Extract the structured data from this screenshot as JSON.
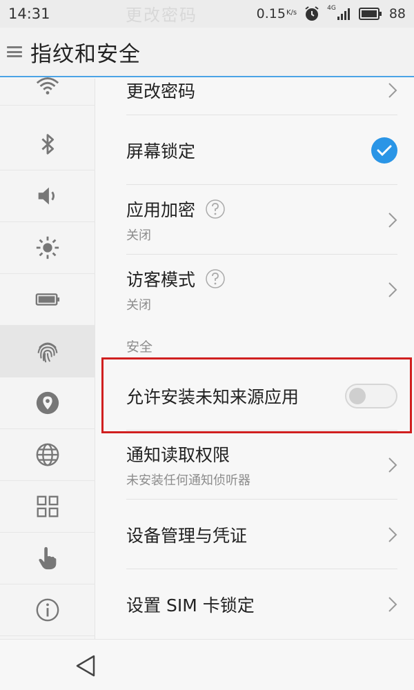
{
  "status_bar": {
    "time": "14:31",
    "speed": "0.15",
    "speed_unit": "K/s",
    "network": "4G",
    "battery": "88",
    "ghost_text": "更改密码"
  },
  "header": {
    "title": "指纹和安全"
  },
  "rail": {
    "items": [
      {
        "icon": "wifi-icon"
      },
      {
        "icon": "bluetooth-icon"
      },
      {
        "icon": "volume-icon"
      },
      {
        "icon": "brightness-icon"
      },
      {
        "icon": "battery-icon"
      },
      {
        "icon": "fingerprint-icon",
        "active": true
      },
      {
        "icon": "location-icon"
      },
      {
        "icon": "globe-icon"
      },
      {
        "icon": "apps-grid-icon"
      },
      {
        "icon": "gesture-hand-icon"
      },
      {
        "icon": "info-icon"
      }
    ]
  },
  "list": {
    "change_password": "更改密码",
    "screen_lock": "屏幕锁定",
    "app_encryption": {
      "title": "应用加密",
      "sub": "关闭"
    },
    "guest_mode": {
      "title": "访客模式",
      "sub": "关闭"
    },
    "section_security": "安全",
    "unknown_sources": {
      "title": "允许安装未知来源应用",
      "enabled": false
    },
    "notification_access": {
      "title": "通知读取权限",
      "sub": "未安装任何通知侦听器"
    },
    "device_admin": "设备管理与凭证",
    "sim_lock": "设置 SIM 卡锁定"
  },
  "colors": {
    "accent": "#2a95e6",
    "highlight": "#d01f1f"
  }
}
